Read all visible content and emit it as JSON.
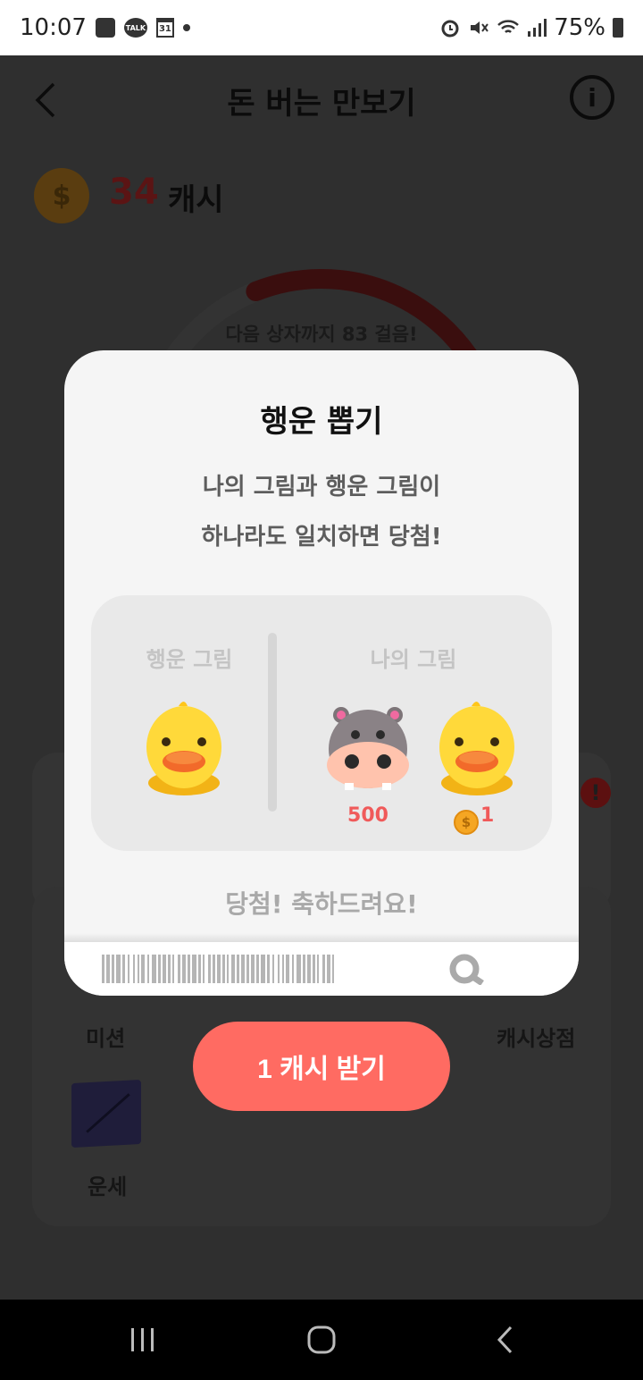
{
  "status_bar": {
    "time": "10:07",
    "talk_label": "TALK",
    "calendar_day": "31",
    "battery": "75%"
  },
  "header": {
    "title": "돈 버는 만보기",
    "info_label": "i"
  },
  "cash": {
    "amount": "34",
    "unit": "캐시"
  },
  "progress": {
    "text": "다음 상자까지 83 걸음!",
    "fraction": 0.25
  },
  "menu": {
    "mission": "미션",
    "cash_shop": "캐시상점",
    "fortune": "운세"
  },
  "modal": {
    "title": "행운 뽑기",
    "desc_line1": "나의 그림과 행운 그림이",
    "desc_line2": "하나라도 일치하면 당첨!",
    "lucky_label": "행운 그림",
    "my_label": "나의 그림",
    "prize_hippo": "500",
    "prize_duck": "1",
    "result": "당첨! 축하드려요!"
  },
  "cta": {
    "label": "1 캐시 받기"
  },
  "colors": {
    "accent": "#ff6b62",
    "prize_red": "#f05a5a",
    "dim_bg": "#2f2f2f"
  }
}
